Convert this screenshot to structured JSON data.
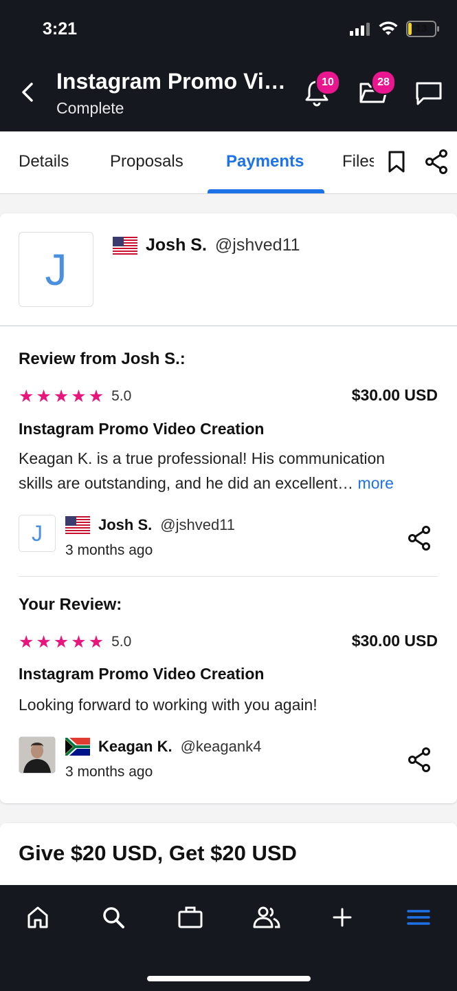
{
  "status": {
    "time": "3:21",
    "battery": "13"
  },
  "header": {
    "title": "Instagram Promo Video Creation",
    "subtitle": "Complete",
    "notifications_count": "10",
    "projects_count": "28"
  },
  "tabs": [
    {
      "label": "Details"
    },
    {
      "label": "Proposals"
    },
    {
      "label": "Payments"
    },
    {
      "label": "Files"
    }
  ],
  "client": {
    "initial": "J",
    "name": "Josh S.",
    "handle": "@jshved11",
    "flag": "us-flag"
  },
  "review_from": {
    "heading": "Review from Josh S.:",
    "rating": "5.0",
    "amount": "$30.00 USD",
    "project": "Instagram Promo Video Creation",
    "text_line1": "Keagan K. is a true professional! His communication",
    "text_line2": "skills are outstanding, and he did an excellent…",
    "more_label": "more",
    "author_initial": "J",
    "author_name": "Josh S.",
    "author_handle": "@jshved11",
    "time_ago": "3 months ago"
  },
  "your_review": {
    "heading": "Your Review:",
    "rating": "5.0",
    "amount": "$30.00 USD",
    "project": "Instagram Promo Video Creation",
    "text": "Looking forward to working with you again!",
    "author_name": "Keagan K.",
    "author_handle": "@keagank4",
    "time_ago": "3 months ago",
    "flag": "za-flag"
  },
  "promo": {
    "title": "Give $20 USD, Get $20 USD"
  },
  "colors": {
    "accent": "#1d72e8",
    "star": "#e8167c",
    "badge": "#e8168f",
    "dark": "#161820"
  }
}
